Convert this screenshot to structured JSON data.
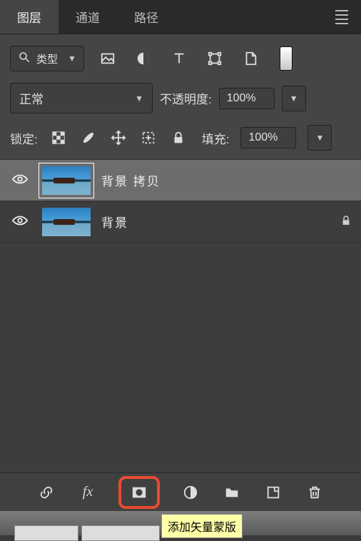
{
  "tabs": {
    "layers": "图层",
    "channels": "通道",
    "paths": "路径"
  },
  "filter": {
    "type_label": "类型"
  },
  "blend": {
    "mode": "正常",
    "opacity_label": "不透明度:",
    "opacity_value": "100%"
  },
  "lock": {
    "label": "锁定:",
    "fill_label": "填充:",
    "fill_value": "100%"
  },
  "layers": {
    "items": [
      {
        "name": "背景 拷贝",
        "selected": true,
        "locked": false
      },
      {
        "name": "背景",
        "selected": false,
        "locked": true
      }
    ]
  },
  "bottombar": {
    "fx": "fx"
  },
  "tooltip": "添加矢量蒙版"
}
